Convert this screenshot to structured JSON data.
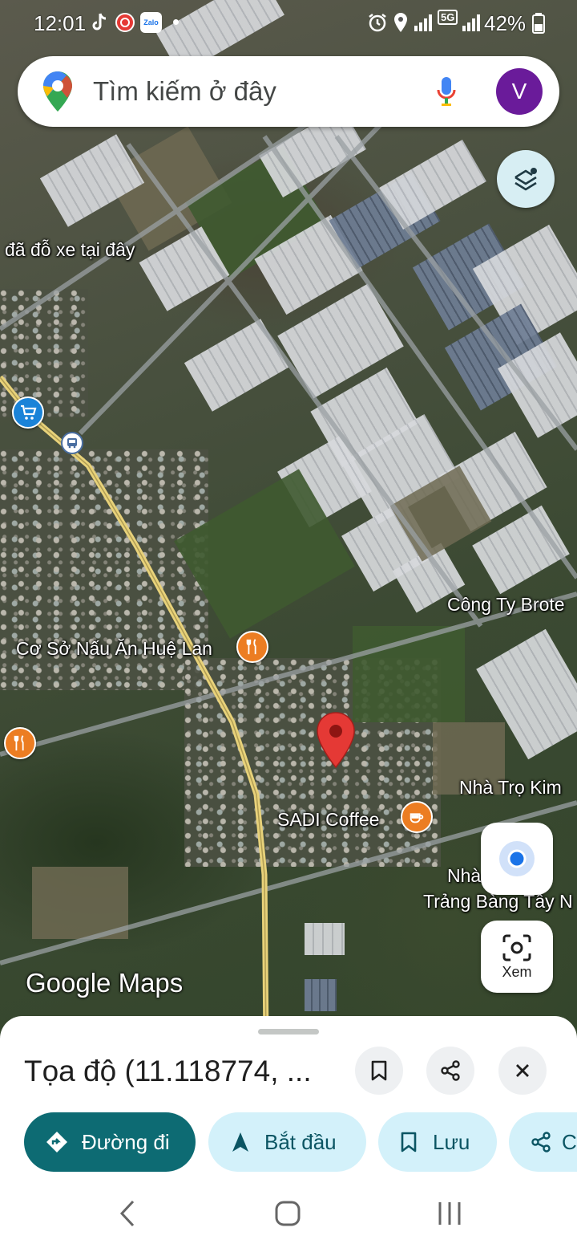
{
  "status_bar": {
    "time": "12:01",
    "zalo_label": "Zalo",
    "network": "5G",
    "battery": "42%"
  },
  "search": {
    "placeholder": "Tìm kiếm ở đây",
    "avatar_initial": "V"
  },
  "map": {
    "labels": {
      "parked": "đã đỗ xe tại đây",
      "brotex": "Công Ty Brote",
      "hue_lan": "Cơ Sở Nấu Ăn Huệ Lan",
      "nha_tro_kim": "Nhà Trọ Kim",
      "sadi": "SADI Coffee",
      "nha_fragment": "Nhà",
      "trang_bang": "Trảng Bàng Tây N"
    },
    "watermark": "Google Maps",
    "lens_label": "Xem"
  },
  "sheet": {
    "title": "Tọa độ (11.118774, ...",
    "actions": {
      "directions": "Đường đi",
      "start": "Bắt đầu",
      "save": "Lưu",
      "share_partial": "C"
    }
  },
  "colors": {
    "primary_teal": "#0d6b73",
    "chip_bg": "#d3f1fa",
    "pin_red": "#e53935",
    "food_orange": "#ec7d22",
    "road_yellow": "#e8d27a"
  }
}
